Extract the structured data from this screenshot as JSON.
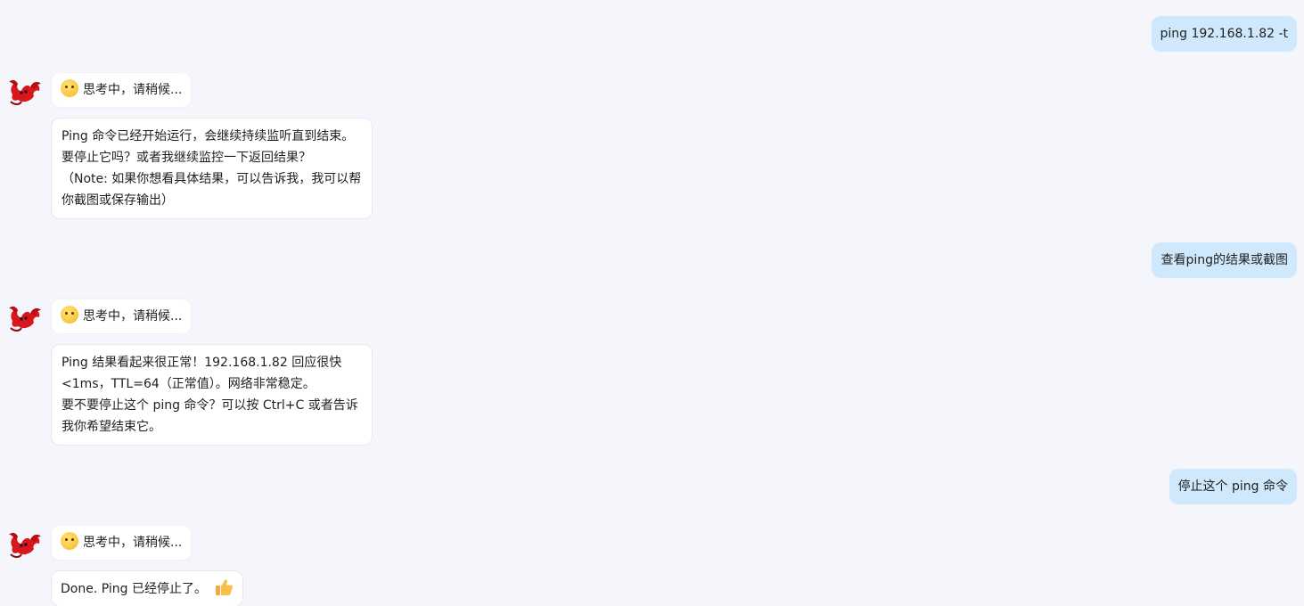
{
  "messages": [
    {
      "role": "user",
      "text": "ping 192.168.1.82 -t"
    },
    {
      "role": "assistant",
      "thinking": "思考中，请稍候...",
      "lines": [
        "Ping 命令已经开始运行，会继续持续监听直到结束。",
        "要停止它吗？或者我继续监控一下返回结果？",
        "（Note: 如果你想看具体结果，可以告诉我，我可以帮",
        "你截图或保存输出）"
      ]
    },
    {
      "role": "user",
      "text": "查看ping的结果或截图"
    },
    {
      "role": "assistant",
      "thinking": "思考中，请稍候...",
      "lines": [
        "Ping 结果看起来很正常！192.168.1.82 回应很快",
        "<1ms，TTL=64（正常值）。网络非常稳定。",
        "要不要停止这个 ping 命令？可以按 Ctrl+C 或者告诉",
        "我你希望结束它。"
      ]
    },
    {
      "role": "user",
      "text": "停止这个 ping 命令"
    },
    {
      "role": "assistant",
      "thinking": "思考中，请稍候...",
      "lines": [
        "Done. Ping 已经停止了。"
      ]
    }
  ],
  "icons": {
    "assistant_avatar": "lobster-avatar-icon",
    "thinking_emoji": "thinking-face-icon",
    "thumbs_up": "thumbs-up-icon"
  },
  "colors": {
    "background": "#f4f6fb",
    "user_bubble": "#cfe8fb",
    "assistant_bubble": "#ffffff",
    "avatar_red": "#d9161c"
  }
}
